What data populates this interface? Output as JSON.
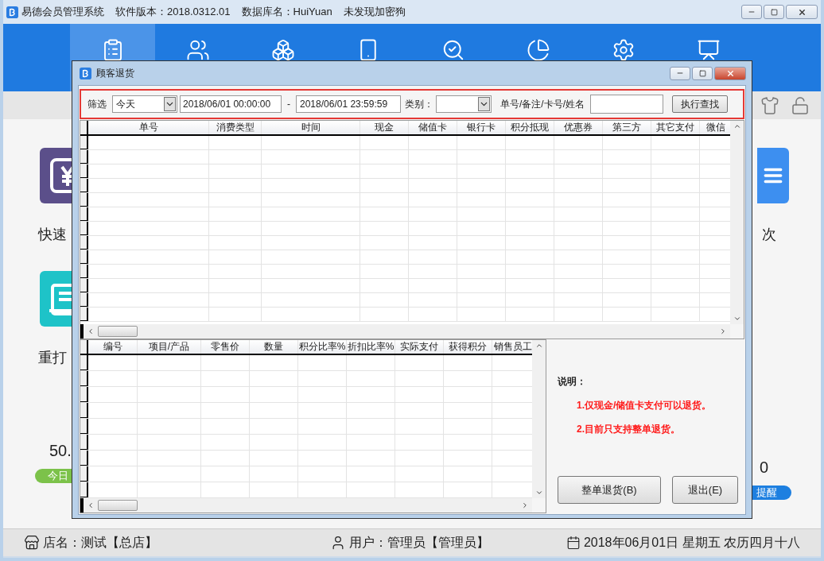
{
  "app": {
    "title": "易德会员管理系统",
    "version": "软件版本：2018.0312.01",
    "database": "数据库名：HuiYuan",
    "dongle": "未发现加密狗"
  },
  "toolbar": [
    {
      "kind": "clipboard",
      "selected": true
    },
    {
      "kind": "users",
      "selected": false
    },
    {
      "kind": "boxes",
      "selected": false
    },
    {
      "kind": "phone",
      "selected": false
    },
    {
      "kind": "search",
      "selected": false
    },
    {
      "kind": "chart",
      "selected": false
    },
    {
      "kind": "settings",
      "selected": false
    },
    {
      "kind": "board",
      "selected": false
    }
  ],
  "home": {
    "tiles": [
      {
        "kind": "yen",
        "label": "快速",
        "color": "#5b4f8a"
      },
      {
        "kind": "print",
        "label": "重打",
        "color": "#1ec3c8"
      },
      {
        "kind": "list",
        "label": "次",
        "color": "#3d8ff0"
      }
    ],
    "stats": [
      {
        "value": "50.",
        "pill": "今日",
        "color": "#7cc24a"
      },
      {
        "value": "0",
        "pill": "提醒",
        "color": "#1d7fe0"
      }
    ]
  },
  "dialog": {
    "title": "顾客退货",
    "filter": {
      "label": "筛选",
      "period": "今天",
      "start": "2018/06/01 00:00:00",
      "separator": "-",
      "end": "2018/06/01 23:59:59",
      "category_label": "类别：",
      "search_label": "单号/备注/卡号/姓名",
      "button": "执行查找"
    },
    "orders_table": {
      "columns": [
        "单号",
        "消费类型",
        "时间",
        "现金",
        "储值卡",
        "银行卡",
        "积分抵现",
        "优惠券",
        "第三方",
        "其它支付",
        "微信"
      ]
    },
    "items_table": {
      "columns": [
        "编号",
        "项目/产品",
        "零售价",
        "数量",
        "积分比率%",
        "折扣比率%",
        "实际支付",
        "获得积分",
        "销售员工"
      ]
    },
    "notes": {
      "title": "说明：",
      "lines": [
        "1.仅现金/储值卡支付可以退货。",
        "2.目前只支持整单退货。"
      ]
    },
    "buttons": [
      "整单退货(B)",
      "退出(E)"
    ]
  },
  "status_bar": {
    "store": "店名：测试【总店】",
    "user": "用户：管理员【管理员】",
    "date": "2018年06月01日 星期五 农历四月十八"
  }
}
